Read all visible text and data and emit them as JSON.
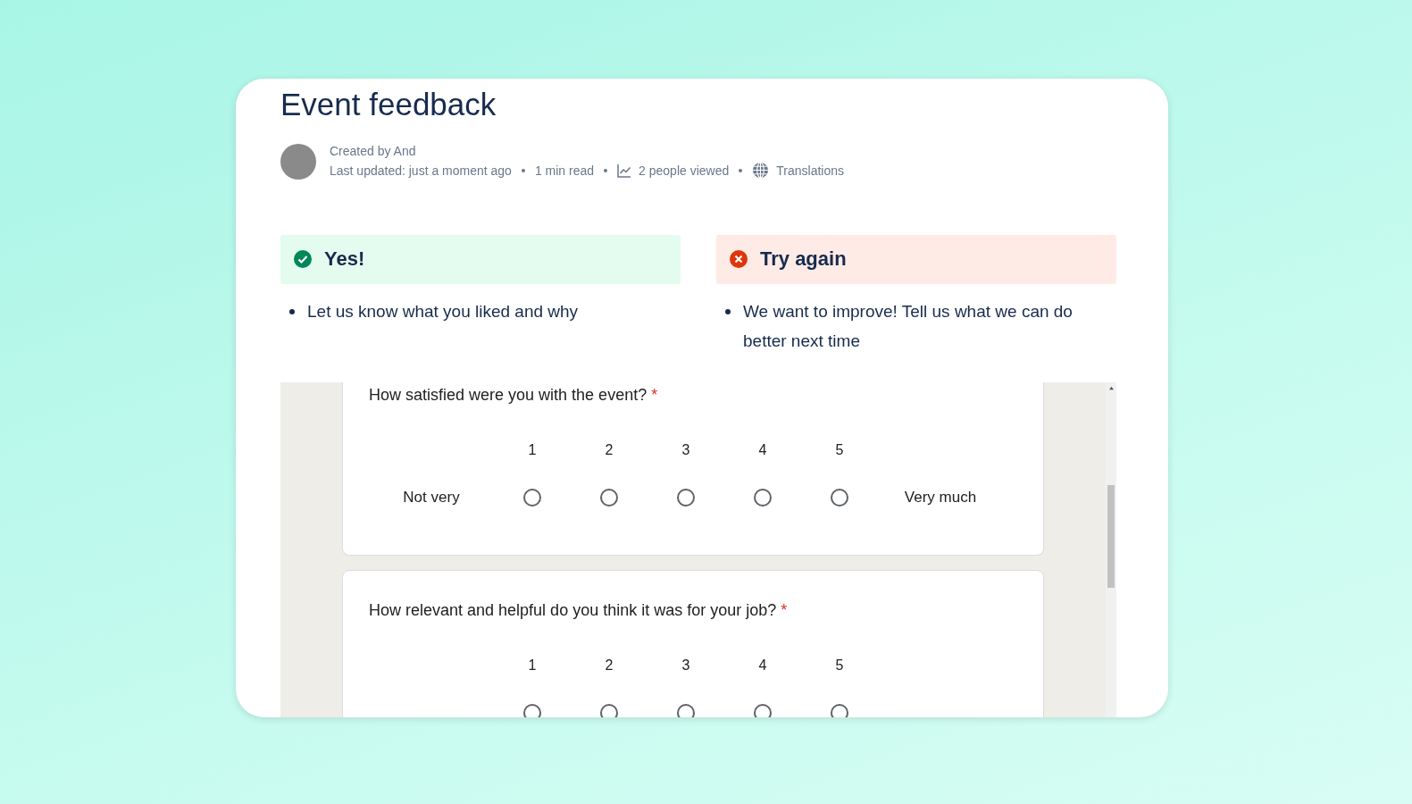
{
  "page": {
    "title": "Event feedback",
    "author_line": "Created by And",
    "meta": [
      {
        "kind": "text",
        "text": "Last updated: just a moment ago"
      },
      {
        "kind": "text",
        "text": "1 min read"
      },
      {
        "kind": "views",
        "text": "2 people viewed"
      },
      {
        "kind": "translations",
        "text": "Translations"
      }
    ]
  },
  "panels": [
    {
      "kind": "success",
      "heading": "Yes!",
      "bullets": [
        "Let us know what you liked and why"
      ]
    },
    {
      "kind": "error",
      "heading": "Try again",
      "bullets": [
        "We want to improve! Tell us what we can do better next time"
      ]
    }
  ],
  "form": {
    "questions": [
      {
        "text": "How satisfied were you with the event?",
        "required_mark": "*",
        "low_label": "Not very",
        "high_label": "Very much",
        "options": [
          {
            "label": "1",
            "selected": false
          },
          {
            "label": "2",
            "selected": false
          },
          {
            "label": "3",
            "selected": false
          },
          {
            "label": "4",
            "selected": false
          },
          {
            "label": "5",
            "selected": false
          }
        ]
      },
      {
        "text": "How relevant and helpful do you think it was for your job?",
        "required_mark": "*",
        "options": [
          {
            "label": "1",
            "selected": false
          },
          {
            "label": "2",
            "selected": false
          },
          {
            "label": "3",
            "selected": false
          },
          {
            "label": "4",
            "selected": false
          },
          {
            "label": "5",
            "selected": false
          }
        ]
      }
    ]
  }
}
